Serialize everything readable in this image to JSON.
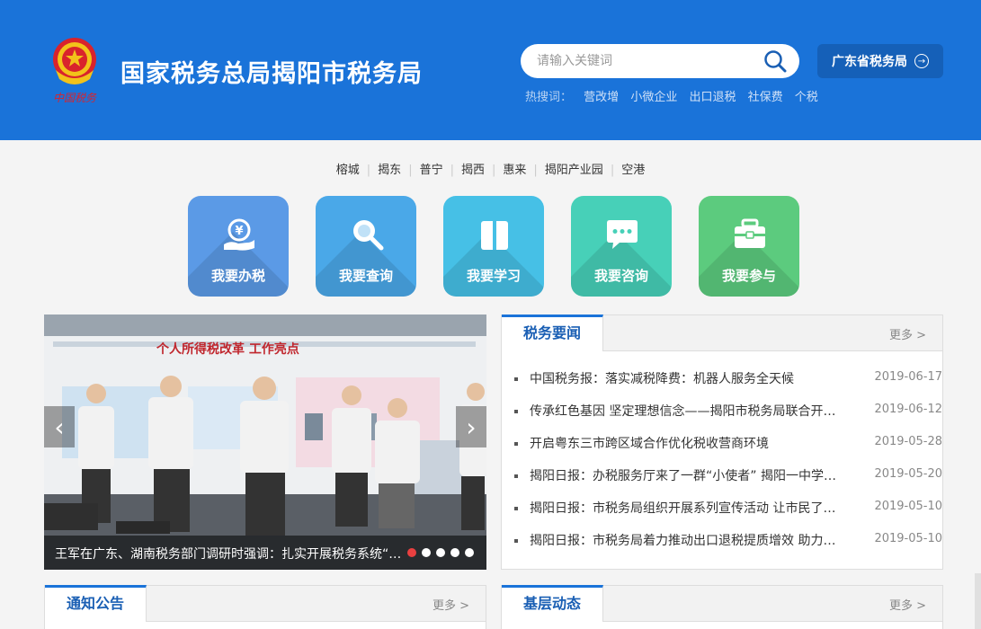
{
  "header": {
    "title": "国家税务总局揭阳市税务局",
    "emblem_text": "中国税务",
    "search_placeholder": "请输入关键词",
    "province_button": "广东省税务局",
    "hot_label": "热搜词：",
    "hot_keywords": [
      "营改增",
      "小微企业",
      "出口退税",
      "社保费",
      "个税"
    ],
    "colors": {
      "header_bg": "#1a73d9",
      "province_bg": "#1560b8"
    }
  },
  "districts": [
    "榕城",
    "揭东",
    "普宁",
    "揭西",
    "惠来",
    "揭阳产业园",
    "空港"
  ],
  "tiles": [
    {
      "label": "我要办税",
      "icon": "hand-yuan-icon",
      "color": "#5b9ae6"
    },
    {
      "label": "我要查询",
      "icon": "magnifier-icon",
      "color": "#4aa8e8"
    },
    {
      "label": "我要学习",
      "icon": "book-icon",
      "color": "#46c0e6"
    },
    {
      "label": "我要咨询",
      "icon": "chat-bubble-icon",
      "color": "#47d0b8"
    },
    {
      "label": "我要参与",
      "icon": "briefcase-icon",
      "color": "#5ccb7e"
    }
  ],
  "carousel": {
    "banner_text": "个人所得税改革 工作亮点",
    "caption": "王军在广东、湖南税务部门调研时强调：扎实开展税务系统“不忘初心、牢记使命”主题教育",
    "slide_count": 5,
    "active_slide": 1
  },
  "news_panel": {
    "tab": "税务要闻",
    "more": "更多 >",
    "items": [
      {
        "title": "中国税务报：落实减税降费：机器人服务全天候",
        "date": "2019-06-17"
      },
      {
        "title": "传承红色基因 坚定理想信念——揭阳市税务局联合开展主题党日活动",
        "date": "2019-06-12"
      },
      {
        "title": "开启粤东三市跨区域合作优化税收营商环境",
        "date": "2019-05-28"
      },
      {
        "title": "揭阳日报：办税服务厅来了一群“小使者” 揭阳一中学子体验税务工作",
        "date": "2019-05-20"
      },
      {
        "title": "揭阳日报：市税务局组织开展系列宣传活动 让市民了解减税降费政策",
        "date": "2019-05-10"
      },
      {
        "title": "揭阳日报：市税务局着力推动出口退税提质增效 助力外贸企业发展",
        "date": "2019-05-10"
      }
    ]
  },
  "notice_panel": {
    "tab": "通知公告",
    "more": "更多 >"
  },
  "local_panel": {
    "tab": "基层动态",
    "more": "更多 >"
  }
}
